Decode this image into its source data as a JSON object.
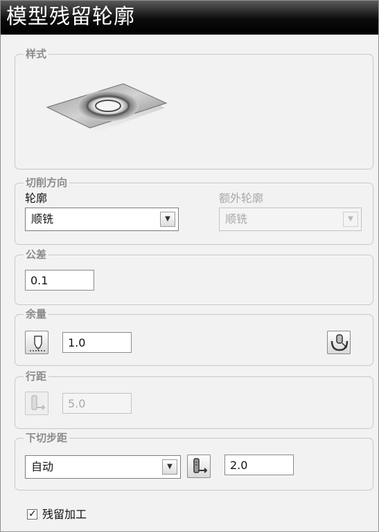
{
  "window": {
    "title": "模型残留轮廓"
  },
  "style_group": {
    "legend": "样式"
  },
  "cut_direction_group": {
    "legend": "切削方向",
    "contour": {
      "label": "轮廓",
      "selected": "顺铣"
    },
    "extra_contour": {
      "label": "额外轮廓",
      "selected": "顺铣"
    }
  },
  "tolerance_group": {
    "legend": "公差",
    "value": "0.1"
  },
  "allowance_group": {
    "legend": "余量",
    "value": "1.0"
  },
  "stepover_group": {
    "legend": "行距",
    "value": "5.0"
  },
  "stepdown_group": {
    "legend": "下切步距",
    "mode": "自动",
    "value": "2.0"
  },
  "rest_machining": {
    "label": "残留加工",
    "checked": true
  },
  "icons": {
    "preview": "model-rest-contour-preview-icon",
    "allowance_left": "component-allowance-icon",
    "allowance_right": "allowance-surface-icon",
    "stepover": "tool-stepover-icon",
    "stepdown": "tool-stepdown-icon",
    "dropdown": "chevron-down-icon",
    "check": "check-icon"
  }
}
